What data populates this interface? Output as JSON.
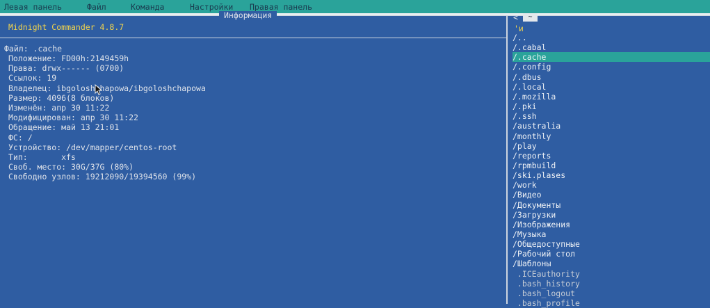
{
  "menu": [
    "Левая панель",
    "Файл",
    "Команда",
    "Настройки",
    "Правая панель"
  ],
  "info_panel": {
    "title": "Информация",
    "version": "Midnight Commander 4.8.7",
    "file_line": "Файл: .cache",
    "lines": [
      "Положение: FD00h:2149459h",
      "Права: drwx------ (0700)",
      "Ссылок: 19",
      "Владелец: ibgoloshchapowa/ibgoloshchapowa",
      "Размер: 4096(8 блоков)",
      "Изменён: апр 30 11:22",
      "Модифицирован: апр 30 11:22",
      "Обращение: май 13 21:01",
      "ФС: /",
      "Устройство: /dev/mapper/centos-root",
      "Тип:       xfs",
      "Своб. место: 30G/37G (80%)",
      "Свободно узлов: 19212090/19394560 (99%)"
    ]
  },
  "right_panel": {
    "top_arrow": "<",
    "top_button": "~",
    "header": "'и",
    "selected_index": 2,
    "items": [
      "/..",
      "/.cabal",
      "/.cache",
      "/.config",
      "/.dbus",
      "/.local",
      "/.mozilla",
      "/.pki",
      "/.ssh",
      "/australia",
      "/monthly",
      "/play",
      "/reports",
      "/rpmbuild",
      "/ski.plases",
      "/work",
      "/Видео",
      "/Документы",
      "/Загрузки",
      "/Изображения",
      "/Музыка",
      "/Общедоступные",
      "/Рабочий стол",
      "/Шаблоны",
      " .ICEauthority",
      " .bash_history",
      " .bash_logout",
      " .bash_profile"
    ]
  }
}
